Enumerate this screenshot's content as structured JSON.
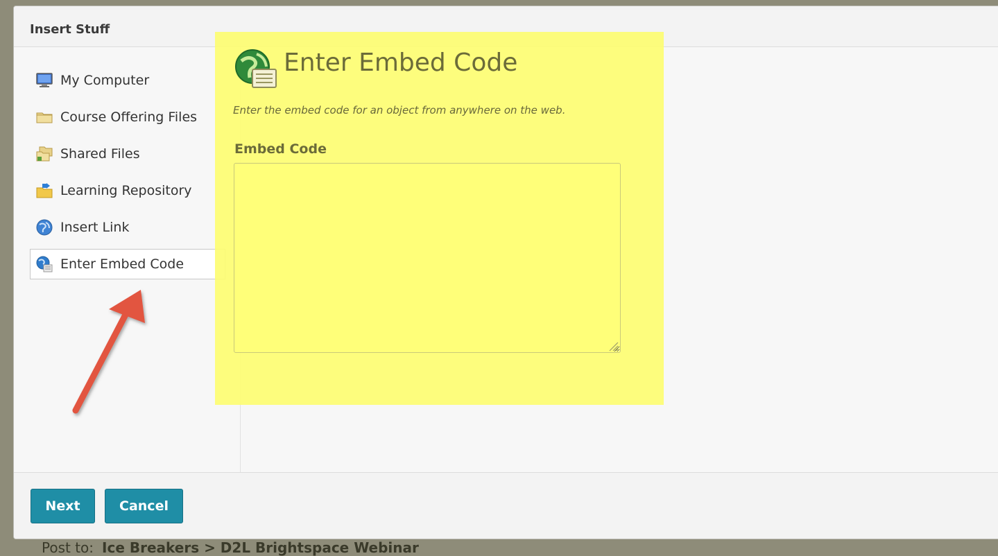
{
  "dialog": {
    "title": "Insert Stuff"
  },
  "sidebar": {
    "items": [
      {
        "label": "My Computer",
        "icon": "monitor-icon",
        "selected": false
      },
      {
        "label": "Course Offering Files",
        "icon": "folder-icon",
        "selected": false
      },
      {
        "label": "Shared Files",
        "icon": "shared-folder-icon",
        "selected": false
      },
      {
        "label": "Learning Repository",
        "icon": "repository-folder-icon",
        "selected": false
      },
      {
        "label": "Insert Link",
        "icon": "globe-icon",
        "selected": false
      },
      {
        "label": "Enter Embed Code",
        "icon": "embed-globe-icon",
        "selected": true
      }
    ]
  },
  "panel": {
    "title": "Enter Embed Code",
    "description": "Enter the embed code for an object from anywhere on the web.",
    "field_label": "Embed Code",
    "field_value": ""
  },
  "footer": {
    "next_label": "Next",
    "cancel_label": "Cancel"
  },
  "background": {
    "post_to_label": "Post to:",
    "post_to_path": "Ice Breakers > D2L Brightspace Webinar"
  },
  "colors": {
    "button": "#1f8ea6",
    "highlight": "#fdfd72",
    "arrow": "#e2543f"
  }
}
